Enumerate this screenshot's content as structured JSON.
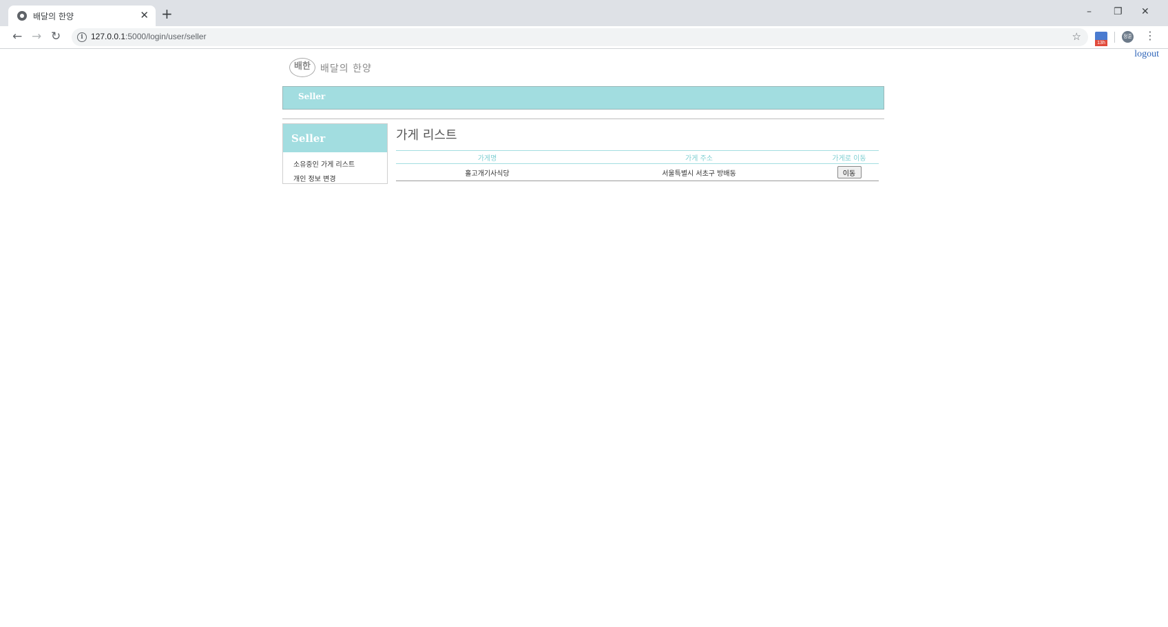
{
  "browser": {
    "tab_title": "배달의 한양",
    "tab_close": "✕",
    "new_tab": "+",
    "url_host": "127.0.0.1",
    "url_path": ":5000/login/user/seller",
    "controls": {
      "minimize": "–",
      "restore": "❐",
      "close": "✕"
    },
    "nav": {
      "back": "←",
      "forward": "→",
      "reload": "↻"
    },
    "info_icon": "i",
    "star_icon": "☆",
    "calendar_badge": "13h",
    "profile_label": "정훈",
    "menu_icon": "⋮"
  },
  "header": {
    "logout": "logout",
    "logo_mark": "배한",
    "logo_text": "배달의 한양",
    "banner_label": "Seller"
  },
  "sidebar": {
    "title": "Seller",
    "items": [
      {
        "label": "소유중인 가게 리스트"
      },
      {
        "label": "개인 정보 변경"
      }
    ]
  },
  "main": {
    "title": "가게 리스트",
    "columns": [
      "가게명",
      "가게 주소",
      "가게로 이동"
    ],
    "rows": [
      {
        "name": "홀고개기사식당",
        "address": "서울특별시 서초구 방배동",
        "button": "이동"
      }
    ]
  },
  "colors": {
    "accent": "#a2dde0",
    "header_text": "#7fcfd2",
    "link": "#2d63b8"
  }
}
